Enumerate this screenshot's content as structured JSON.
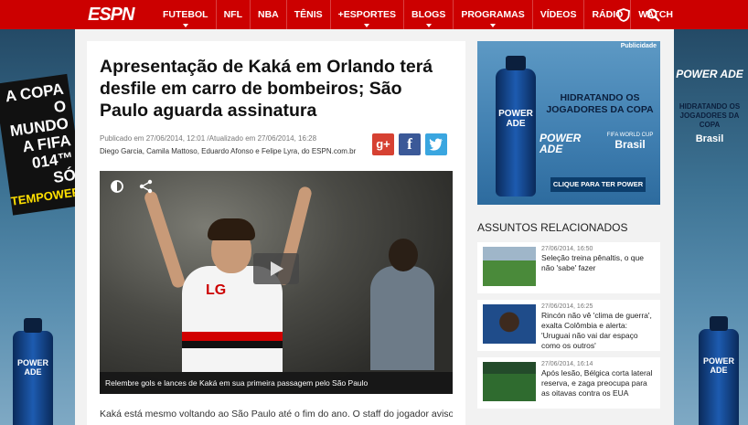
{
  "header": {
    "logo": "ESPN",
    "nav": [
      {
        "label": "FUTEBOL",
        "caret": true
      },
      {
        "label": "NFL",
        "caret": false
      },
      {
        "label": "NBA",
        "caret": false
      },
      {
        "label": "TÊNIS",
        "caret": false
      },
      {
        "label": "+ESPORTES",
        "caret": true
      },
      {
        "label": "BLOGS",
        "caret": true
      },
      {
        "label": "PROGRAMAS",
        "caret": true
      },
      {
        "label": "VÍDEOS",
        "caret": false
      },
      {
        "label": "RÁDIO",
        "caret": false
      },
      {
        "label": "WATCH",
        "caret": false
      }
    ]
  },
  "skin": {
    "left_slogan_lines": [
      "A COPA",
      "O MUNDO",
      "A FIFA",
      "014™ SÓ",
      "TEMPOWER"
    ],
    "bottle_label": "POWER ADE",
    "right_logo": "POWER ADE",
    "right_text": "HIDRATANDO OS JOGADORES DA COPA",
    "right_brasil": "Brasil"
  },
  "article": {
    "title": "Apresentação de Kaká em Orlando terá desfile em carro de bombeiros; São Paulo aguarda assinatura",
    "meta": "Publicado em 27/06/2014, 12:01 /Atualizado em 27/06/2014, 16:28",
    "authors": "Diego Garcia, Camila Mattoso, Eduardo Afonso e Felipe Lyra, do ESPN.com.br",
    "share": {
      "google": "g+",
      "facebook": "f",
      "twitter": "t"
    },
    "shirt_text": "LG",
    "caption": "Relembre gols e lances de Kaká em sua primeira passagem pelo São Paulo",
    "body": "Kaká está mesmo voltando ao São Paulo até o fim do ano. O staff do jogador avisou ao"
  },
  "ad": {
    "label": "Publicidade",
    "bottle_label": "POWER ADE",
    "headline": "HIDRATANDO OS JOGADORES DA COPA",
    "brand": "POWER ADE",
    "fifa": "FIFA WORLD CUP",
    "brasil": "Brasil",
    "cta": "CLIQUE PARA TER POWER"
  },
  "related": {
    "heading": "ASSUNTOS RELACIONADOS",
    "items": [
      {
        "date": "27/06/2014, 16:50",
        "title": "Seleção treina pênaltis, o que não 'sabe' fazer"
      },
      {
        "date": "27/06/2014, 16:25",
        "title": "Rincón não vê 'clima de guerra', exalta Colômbia e alerta: 'Uruguai não vai dar espaço como os outros'"
      },
      {
        "date": "27/06/2014, 16:14",
        "title": "Após lesão, Bélgica corta lateral reserva, e zaga preocupa para as oitavas contra os EUA"
      }
    ]
  }
}
